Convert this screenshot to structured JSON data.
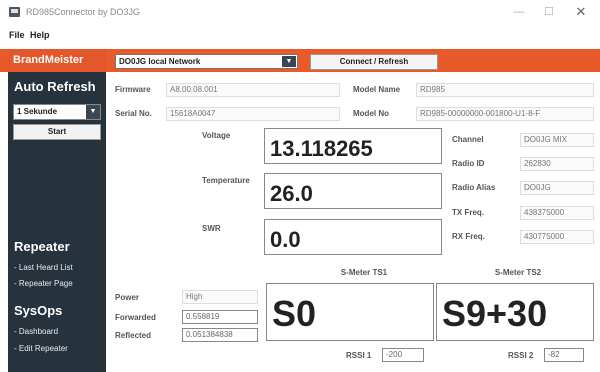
{
  "window": {
    "title": "RD985Connector by DO3JG",
    "min_glyph": "—",
    "max_glyph": "☐",
    "close_glyph": "✕"
  },
  "menu": {
    "file": "File",
    "help": "Help"
  },
  "sidebar": {
    "brand": "BrandMeister",
    "auto_refresh_heading": "Auto Refresh",
    "interval_value": "1 Sekunde",
    "start_label": "Start",
    "repeater_heading": "Repeater",
    "repeater_links": [
      "- Last Heard List",
      "- Repeater Page"
    ],
    "sysops_heading": "SysOps",
    "sysops_links": [
      "- Dashboard",
      "- Edit Repeater"
    ]
  },
  "toolbar": {
    "network_value": "DO0JG local Network",
    "connect_label": "Connect / Refresh"
  },
  "info": {
    "firmware_label": "Firmware",
    "firmware_value": "A8.00.08.001",
    "serial_label": "Serial No.",
    "serial_value": "15618A0047",
    "model_name_label": "Model Name",
    "model_name_value": "RD985",
    "model_no_label": "Model No",
    "model_no_value": "RD985-00000000-001800-U1-8-F"
  },
  "readings": {
    "voltage_label": "Voltage",
    "voltage_value": "13.118265",
    "temperature_label": "Temperature",
    "temperature_value": "26.0",
    "swr_label": "SWR",
    "swr_value": "0.0"
  },
  "channel": {
    "channel_label": "Channel",
    "channel_value": "DO0JG MIX",
    "radio_id_label": "Radio ID",
    "radio_id_value": "262830",
    "radio_alias_label": "Radio Alias",
    "radio_alias_value": "DO0JG",
    "tx_label": "TX Freq.",
    "tx_value": "438375000",
    "rx_label": "RX Freq.",
    "rx_value": "430775000"
  },
  "power": {
    "power_label": "Power",
    "power_value": "High",
    "forwarded_label": "Forwarded",
    "forwarded_value": "0.558819",
    "reflected_label": "Reflected",
    "reflected_value": "0.051384838"
  },
  "smeter": {
    "ts1_label": "S-Meter TS1",
    "ts1_value": "S0",
    "ts2_label": "S-Meter TS2",
    "ts2_value": "S9+30",
    "rssi1_label": "RSSI 1",
    "rssi1_value": "-200",
    "rssi2_label": "RSSI 2",
    "rssi2_value": "-82"
  }
}
